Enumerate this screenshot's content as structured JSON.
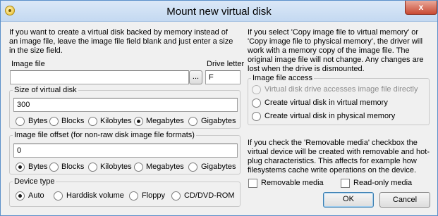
{
  "window": {
    "title": "Mount new virtual disk",
    "close_glyph": "x"
  },
  "left": {
    "intro_text": "If you want to create a virtual disk backed by memory instead of an image file, leave the image file field blank and just enter a size in the size field.",
    "image_file_label": "Image file",
    "image_file_value": "",
    "browse_label": "...",
    "drive_letter_label": "Drive letter",
    "drive_letter_value": "F",
    "size_group": {
      "legend": "Size of virtual disk",
      "value": "300",
      "units": [
        "Bytes",
        "Blocks",
        "Kilobytes",
        "Megabytes",
        "Gigabytes"
      ],
      "selected": "Megabytes"
    },
    "offset_group": {
      "legend": "Image file offset (for non-raw disk image file formats)",
      "value": "0",
      "units": [
        "Bytes",
        "Blocks",
        "Kilobytes",
        "Megabytes",
        "Gigabytes"
      ],
      "selected": "Bytes"
    },
    "device_group": {
      "legend": "Device type",
      "options": [
        "Auto",
        "Harddisk volume",
        "Floppy",
        "CD/DVD-ROM"
      ],
      "selected": "Auto"
    }
  },
  "right": {
    "copy_text": "If you select 'Copy image file to virtual memory' or 'Copy image file to physical memory', the driver will work with a memory copy of the image file. The original image file will not change. Any changes are lost when the drive is dismounted.",
    "access_group": {
      "legend": "Image file access",
      "options": [
        {
          "label": "Virtual disk drive accesses image file directly",
          "enabled": false
        },
        {
          "label": "Create virtual disk in virtual memory",
          "enabled": true
        },
        {
          "label": "Create virtual disk in physical memory",
          "enabled": true
        }
      ]
    },
    "removable_text": "If you check the 'Removable media' checkbox the virtual device will be created with removable and hot-plug characteristics. This affects for example how filesystems cache write operations on the device.",
    "removable_media_label": "Removable media",
    "removable_media_checked": false,
    "readonly_media_label": "Read-only media",
    "readonly_media_checked": false,
    "ok_label": "OK",
    "cancel_label": "Cancel"
  },
  "icons": {
    "app": "app-disk-icon",
    "close": "close-icon"
  }
}
